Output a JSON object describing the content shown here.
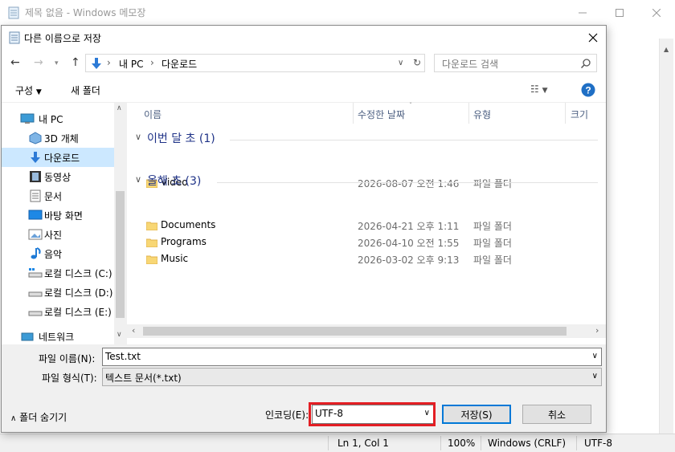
{
  "notepad": {
    "title": "제목 없음 - Windows 메모장",
    "status": {
      "position": "Ln 1, Col 1",
      "zoom": "100%",
      "line_ending": "Windows (CRLF)",
      "encoding": "UTF-8"
    }
  },
  "dialog": {
    "title": "다른 이름으로 저장",
    "breadcrumb": [
      "내 PC",
      "다운로드"
    ],
    "search_placeholder": "다운로드 검색",
    "toolbar": {
      "organize": "구성",
      "new_folder": "새 폴더"
    },
    "nav_items": [
      {
        "label": "내 PC",
        "icon": "pc-icon"
      },
      {
        "label": "3D 개체",
        "icon": "3d-objects-icon"
      },
      {
        "label": "다운로드",
        "icon": "download-icon",
        "selected": true
      },
      {
        "label": "동영상",
        "icon": "video-icon"
      },
      {
        "label": "문서",
        "icon": "document-icon"
      },
      {
        "label": "바탕 화면",
        "icon": "desktop-icon"
      },
      {
        "label": "사진",
        "icon": "pictures-icon"
      },
      {
        "label": "음악",
        "icon": "music-icon"
      },
      {
        "label": "로컬 디스크 (C:)",
        "icon": "drive-icon"
      },
      {
        "label": "로컬 디스크 (D:)",
        "icon": "drive-icon"
      },
      {
        "label": "로컬 디스크 (E:)",
        "icon": "drive-icon"
      },
      {
        "label": "네트워크",
        "icon": "network-icon"
      }
    ],
    "columns": {
      "name": "이름",
      "modified": "수정한 날짜",
      "type": "유형",
      "size": "크기"
    },
    "groups": [
      {
        "header": "이번 달 초 (1)",
        "files": [
          {
            "name": "Video",
            "date": "2026-08-07 오전 1:46",
            "type": "파일 폴더"
          }
        ]
      },
      {
        "header": "올해 초 (3)",
        "files": [
          {
            "name": "Documents",
            "date": "2026-04-21 오후 1:11",
            "type": "파일 폴더"
          },
          {
            "name": "Programs",
            "date": "2026-04-10 오전 1:55",
            "type": "파일 폴더"
          },
          {
            "name": "Music",
            "date": "2026-03-02 오후 9:13",
            "type": "파일 폴더"
          }
        ]
      }
    ],
    "filename_label": "파일 이름(N):",
    "filename_value": "Test.txt",
    "filetype_label": "파일 형식(T):",
    "filetype_value": "텍스트 문서(*.txt)",
    "hide_folders": "폴더 숨기기",
    "encoding_label": "인코딩(E):",
    "encoding_value": "UTF-8",
    "save_button": "저장(S)",
    "cancel_button": "취소",
    "highlight_color": "#e31e24"
  }
}
